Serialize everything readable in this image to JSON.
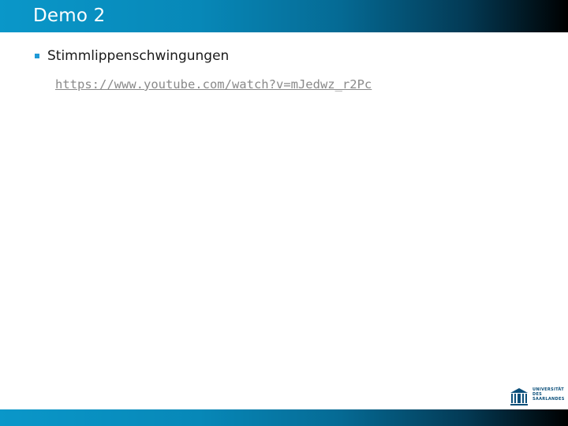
{
  "slide": {
    "title": "Demo 2",
    "bullets": [
      {
        "text": "Stimmlippenschwingungen"
      }
    ],
    "link": "https://www.youtube.com/watch?v=mJedwz_r2Pc"
  },
  "logo": {
    "lines": [
      "UNIVERSITÄT",
      "DES",
      "SAARLANDES"
    ]
  },
  "colors": {
    "bar_start": "#0a97c9",
    "bar_end": "#000000",
    "bullet": "#1f9ad6",
    "link": "#8a8a8a",
    "logo": "#0b4f7a"
  }
}
